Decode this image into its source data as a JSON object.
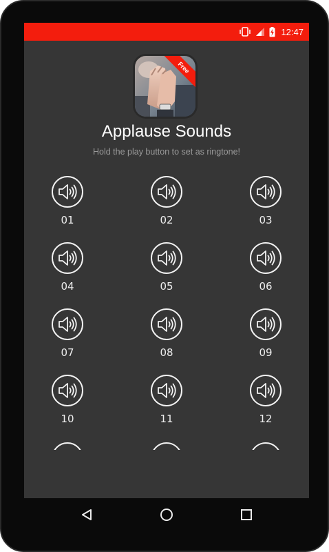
{
  "status_bar": {
    "time": "12:47",
    "color": "#f31d0d",
    "icons": [
      "vibrate-icon",
      "signal-icon",
      "battery-charging-icon"
    ]
  },
  "app": {
    "title": "Applause Sounds",
    "subtitle": "Hold the play button to set as ringtone!",
    "badge": "Free",
    "badge_color": "#f31d0d"
  },
  "sounds": [
    {
      "label": "01"
    },
    {
      "label": "02"
    },
    {
      "label": "03"
    },
    {
      "label": "04"
    },
    {
      "label": "05"
    },
    {
      "label": "06"
    },
    {
      "label": "07"
    },
    {
      "label": "08"
    },
    {
      "label": "09"
    },
    {
      "label": "10"
    },
    {
      "label": "11"
    },
    {
      "label": "12"
    }
  ],
  "navigation": {
    "icons": [
      "back-icon",
      "home-icon",
      "recents-icon"
    ]
  }
}
